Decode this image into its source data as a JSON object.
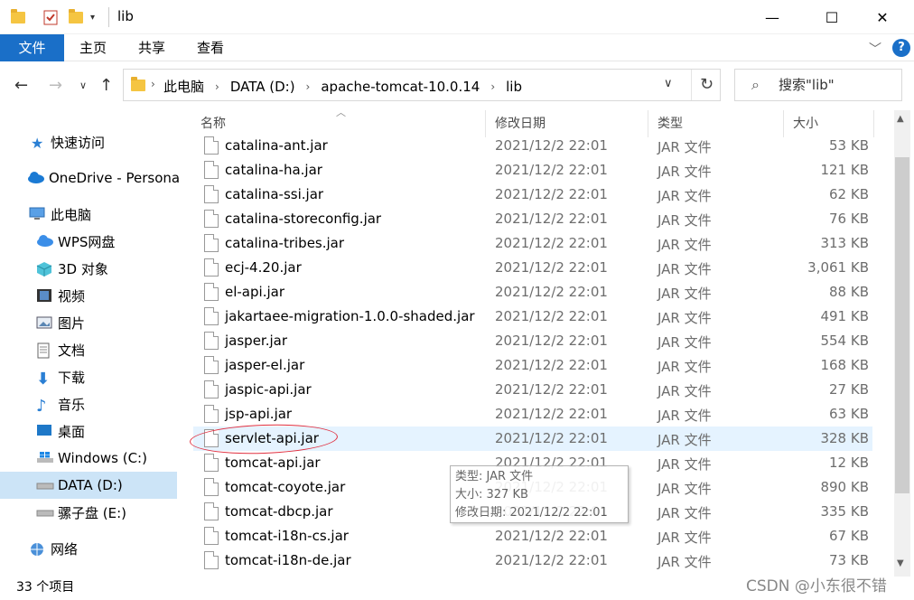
{
  "window": {
    "title": "lib",
    "controls": {
      "minimize": "—",
      "maximize": "☐",
      "close": "✕"
    }
  },
  "ribbon": {
    "tabs": [
      "文件",
      "主页",
      "共享",
      "查看"
    ],
    "help": "?"
  },
  "address": {
    "crumbs": [
      "此电脑",
      "DATA (D:)",
      "apache-tomcat-10.0.14",
      "lib"
    ],
    "search_placeholder": "搜索\"lib\""
  },
  "nav_pane": {
    "items": [
      {
        "label": "快速访问",
        "icon": "star-icon"
      },
      {
        "label": "OneDrive - Persona",
        "icon": "cloud-icon"
      },
      {
        "label": "此电脑",
        "icon": "computer-icon"
      },
      {
        "label": "WPS网盘",
        "icon": "cloud-drive-icon"
      },
      {
        "label": "3D 对象",
        "icon": "cube-icon"
      },
      {
        "label": "视频",
        "icon": "video-icon"
      },
      {
        "label": "图片",
        "icon": "picture-icon"
      },
      {
        "label": "文档",
        "icon": "document-icon"
      },
      {
        "label": "下载",
        "icon": "download-icon"
      },
      {
        "label": "音乐",
        "icon": "music-icon"
      },
      {
        "label": "桌面",
        "icon": "desktop-icon"
      },
      {
        "label": "Windows (C:)",
        "icon": "windows-drive-icon"
      },
      {
        "label": "DATA (D:)",
        "icon": "drive-icon"
      },
      {
        "label": "骡子盘 (E:)",
        "icon": "drive-icon"
      },
      {
        "label": "网络",
        "icon": "network-icon"
      }
    ],
    "selected": "DATA (D:)"
  },
  "columns": [
    "名称",
    "修改日期",
    "类型",
    "大小"
  ],
  "files": [
    {
      "name": "catalina-ant.jar",
      "date": "2021/12/2 22:01",
      "type": "JAR 文件",
      "size": "53 KB"
    },
    {
      "name": "catalina-ha.jar",
      "date": "2021/12/2 22:01",
      "type": "JAR 文件",
      "size": "121 KB"
    },
    {
      "name": "catalina-ssi.jar",
      "date": "2021/12/2 22:01",
      "type": "JAR 文件",
      "size": "62 KB"
    },
    {
      "name": "catalina-storeconfig.jar",
      "date": "2021/12/2 22:01",
      "type": "JAR 文件",
      "size": "76 KB"
    },
    {
      "name": "catalina-tribes.jar",
      "date": "2021/12/2 22:01",
      "type": "JAR 文件",
      "size": "313 KB"
    },
    {
      "name": "ecj-4.20.jar",
      "date": "2021/12/2 22:01",
      "type": "JAR 文件",
      "size": "3,061 KB"
    },
    {
      "name": "el-api.jar",
      "date": "2021/12/2 22:01",
      "type": "JAR 文件",
      "size": "88 KB"
    },
    {
      "name": "jakartaee-migration-1.0.0-shaded.jar",
      "date": "2021/12/2 22:01",
      "type": "JAR 文件",
      "size": "491 KB"
    },
    {
      "name": "jasper.jar",
      "date": "2021/12/2 22:01",
      "type": "JAR 文件",
      "size": "554 KB"
    },
    {
      "name": "jasper-el.jar",
      "date": "2021/12/2 22:01",
      "type": "JAR 文件",
      "size": "168 KB"
    },
    {
      "name": "jaspic-api.jar",
      "date": "2021/12/2 22:01",
      "type": "JAR 文件",
      "size": "27 KB"
    },
    {
      "name": "jsp-api.jar",
      "date": "2021/12/2 22:01",
      "type": "JAR 文件",
      "size": "63 KB"
    },
    {
      "name": "servlet-api.jar",
      "date": "2021/12/2 22:01",
      "type": "JAR 文件",
      "size": "328 KB"
    },
    {
      "name": "tomcat-api.jar",
      "date": "2021/12/2 22:01",
      "type": "JAR 文件",
      "size": "12 KB"
    },
    {
      "name": "tomcat-coyote.jar",
      "date": "2021/12/2 22:01",
      "type": "JAR 文件",
      "size": "890 KB"
    },
    {
      "name": "tomcat-dbcp.jar",
      "date": "2021/12/2 22:01",
      "type": "JAR 文件",
      "size": "335 KB"
    },
    {
      "name": "tomcat-i18n-cs.jar",
      "date": "2021/12/2 22:01",
      "type": "JAR 文件",
      "size": "67 KB"
    },
    {
      "name": "tomcat-i18n-de.jar",
      "date": "2021/12/2 22:01",
      "type": "JAR 文件",
      "size": "73 KB"
    }
  ],
  "hovered_file": "servlet-api.jar",
  "tooltip": {
    "type": "类型: JAR 文件",
    "size": "大小: 327 KB",
    "modified": "修改日期: 2021/12/2 22:01"
  },
  "status": {
    "item_count": "33 个项目"
  },
  "watermark": "CSDN @小东很不错",
  "colors": {
    "accent": "#1a6fc8",
    "selected": "#cce4f7",
    "hover": "#e5f3ff",
    "annotation": "#e03040"
  }
}
